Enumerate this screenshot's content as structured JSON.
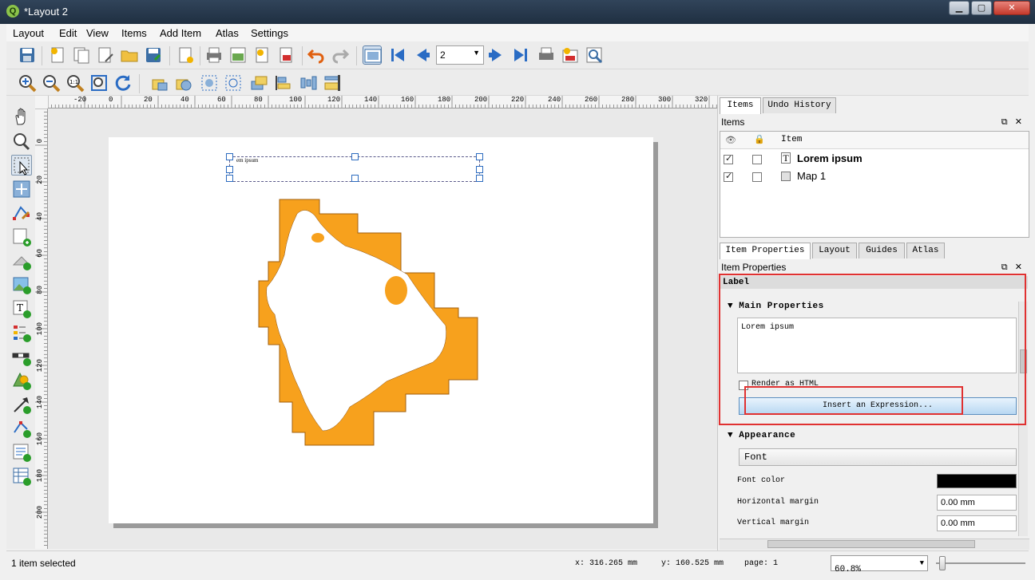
{
  "window": {
    "title": "*Layout 2",
    "app_icon": "qgis-icon"
  },
  "menu": [
    "Layout",
    "Edit",
    "View",
    "Items",
    "Add Item",
    "Atlas",
    "Settings"
  ],
  "toolbar": {
    "page_value": "2"
  },
  "ruler": {
    "h_ticks": [
      "-20",
      "0",
      "20",
      "40",
      "60",
      "80",
      "100",
      "120",
      "140",
      "160",
      "180",
      "200",
      "220",
      "240",
      "260",
      "280",
      "300",
      "320"
    ],
    "v_ticks": [
      "0",
      "20",
      "40",
      "60",
      "80",
      "100",
      "120",
      "140",
      "160",
      "180",
      "200"
    ]
  },
  "canvas": {
    "label_text": "em ipsum",
    "map_color": "#f7a11d"
  },
  "dock": {
    "tabs_top": [
      "Items",
      "Undo History"
    ],
    "items_panel_title": "Items",
    "items_header": "Item",
    "items": [
      {
        "name": "Lorem ipsum",
        "visible": true,
        "locked": false,
        "type": "T"
      },
      {
        "name": "Map 1",
        "visible": true,
        "locked": false,
        "type": "map"
      }
    ],
    "tabs_bottom": [
      "Item Properties",
      "Layout",
      "Guides",
      "Atlas"
    ],
    "props_panel_title": "Item Properties",
    "section": "Label",
    "main_props_header": "Main Properties",
    "label_text": "Lorem ipsum",
    "render_html_label": "Render as HTML",
    "insert_expr_label": "Insert an Expression...",
    "appearance_header": "Appearance",
    "font_button": "Font",
    "font_color_label": "Font color",
    "h_margin_label": "Horizontal margin",
    "h_margin_value": "0.00 mm",
    "v_margin_label": "Vertical margin",
    "v_margin_value": "0.00 mm"
  },
  "status": {
    "selection": "1 item selected",
    "x": "x: 316.265 mm",
    "y": "y: 160.525 mm",
    "page": "page: 1",
    "zoom": "60.8%"
  }
}
